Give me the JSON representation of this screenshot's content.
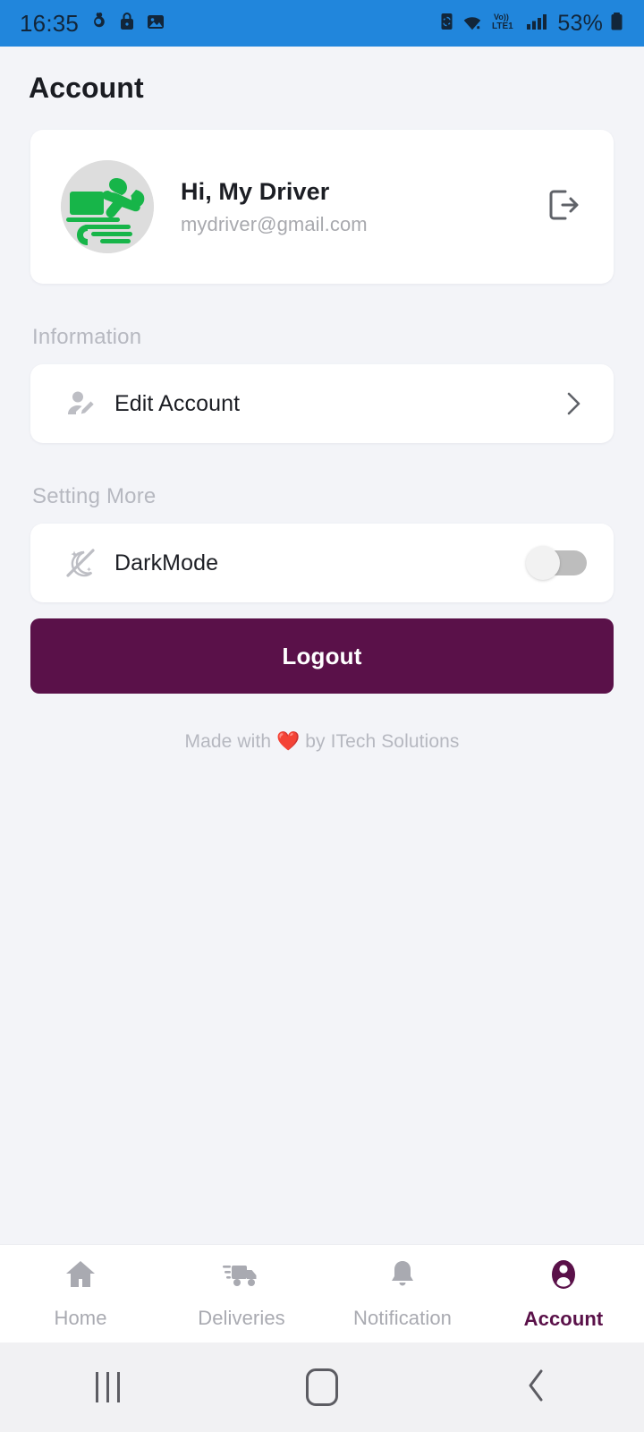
{
  "status_bar": {
    "time": "16:35",
    "battery_percent": "53%",
    "network_label": "Vo)) LTE1",
    "background_color": "#2186DC",
    "left_icons": [
      "do-not-disturb-icon",
      "lock-icon",
      "screenshot-image-icon"
    ],
    "right_icons": [
      "battery-saver-icon",
      "wifi-icon",
      "volte-icon",
      "signal-bars-icon",
      "battery-icon"
    ]
  },
  "header": {
    "title": "Account"
  },
  "profile": {
    "greeting": "Hi, My Driver",
    "email": "mydriver@gmail.com",
    "avatar_name": "delivery-rider-logo",
    "avatar_background": "#DDDDDD",
    "avatar_color": "#17B549",
    "logout_icon": "logout-icon"
  },
  "sections": {
    "information": {
      "label": "Information",
      "items": [
        {
          "label": "Edit Account",
          "icon": "edit-profile-icon",
          "accessory": "chevron-right-icon"
        }
      ]
    },
    "setting_more": {
      "label": "Setting More",
      "items": [
        {
          "label": "DarkMode",
          "icon": "dark-mode-icon",
          "accessory": "toggle-switch",
          "toggle_on": false
        }
      ]
    }
  },
  "logout_button": {
    "label": "Logout",
    "color": "#5A1149",
    "text_color": "#FFFFFF"
  },
  "credit": {
    "prefix": "Made with",
    "heart": "❤️",
    "suffix": "by ITech Solutions"
  },
  "bottom_nav": {
    "active_index": 3,
    "active_color": "#5A1149",
    "inactive_color": "#A9AAB1",
    "items": [
      {
        "label": "Home",
        "icon": "home-icon"
      },
      {
        "label": "Deliveries",
        "icon": "delivery-truck-icon"
      },
      {
        "label": "Notification",
        "icon": "bell-icon"
      },
      {
        "label": "Account",
        "icon": "person-circle-icon"
      }
    ]
  },
  "system_nav": {
    "items": [
      {
        "name": "recents-button",
        "icon": "recents-icon"
      },
      {
        "name": "home-button",
        "icon": "home-square-icon"
      },
      {
        "name": "back-button",
        "icon": "back-chevron-icon"
      }
    ]
  },
  "theme": {
    "page_background": "#F3F4F8",
    "card_background": "#FFFFFF",
    "section_label_color": "#B6B8C0"
  }
}
